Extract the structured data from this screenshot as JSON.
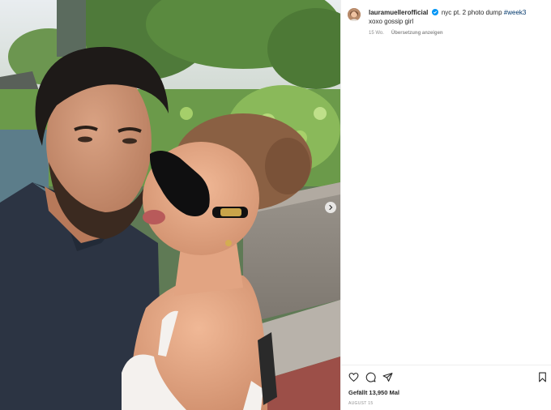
{
  "post": {
    "username": "lauramuellerofficial",
    "caption_text": "nyc pt. 2 photo dump",
    "hashtag": "#week3",
    "caption_line2": "xoxo gossip girl",
    "time_ago": "15 Wo.",
    "translate_label": "Übersetzung anzeigen",
    "likes": "Gefällt 13,950 Mal",
    "date": "AUGUST 15"
  },
  "icons": {
    "avatar": "avatar",
    "verified": "verified-badge-icon",
    "next": "chevron-right-icon",
    "like": "heart-icon",
    "comment": "comment-bubble-icon",
    "share": "paper-plane-icon",
    "save": "bookmark-icon"
  },
  "colors": {
    "accent": "#0095f6",
    "hashtag": "#00376b",
    "text": "#262626",
    "muted": "#8e8e8e"
  }
}
